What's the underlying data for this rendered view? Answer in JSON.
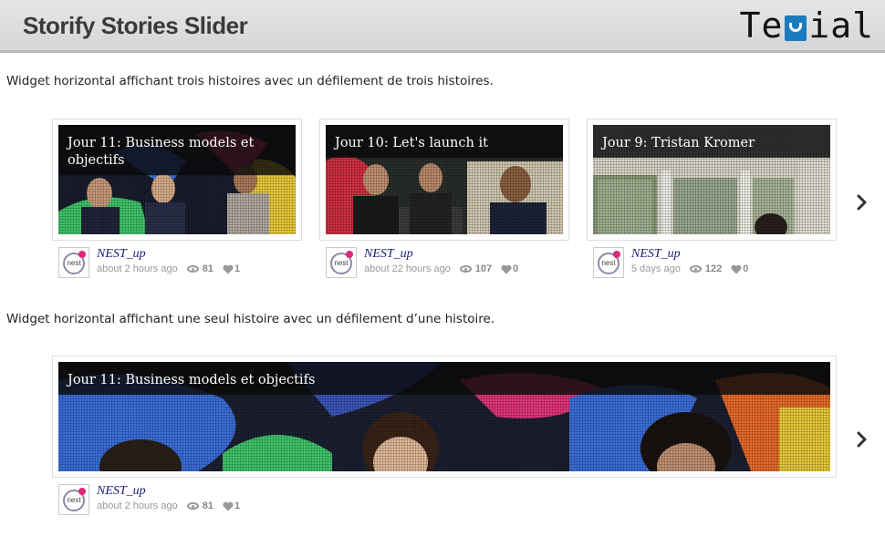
{
  "header": {
    "title": "Storify Stories Slider",
    "logo_text_left": "Te",
    "logo_text_right": "ial"
  },
  "section1": {
    "description": "Widget horizontal affichant trois histoires avec un défilement de trois histoires.",
    "stories": [
      {
        "title": "Jour 11: Business models et objectifs",
        "author": "NEST_up",
        "time": "about 2 hours ago",
        "views": "81",
        "likes": "1"
      },
      {
        "title": "Jour 10: Let's launch it",
        "author": "NEST_up",
        "time": "about 22 hours ago",
        "views": "107",
        "likes": "0"
      },
      {
        "title": "Jour 9: Tristan Kromer",
        "author": "NEST_up",
        "time": "5 days ago",
        "views": "122",
        "likes": "0"
      }
    ]
  },
  "section2": {
    "description": "Widget horizontal affichant une seul histoire avec un défilement d’une histoire.",
    "stories": [
      {
        "title": "Jour 11: Business models et objectifs",
        "author": "NEST_up",
        "time": "about 2 hours ago",
        "views": "81",
        "likes": "1"
      }
    ]
  },
  "avatar_text": "nest",
  "icons": {
    "next": "chevron-right-icon",
    "views": "eye-icon",
    "likes": "heart-icon"
  },
  "colors": {
    "logo_accent": "#1a7cc0",
    "author_link": "#1a1a7a",
    "avatar_dot": "#e0287a"
  }
}
